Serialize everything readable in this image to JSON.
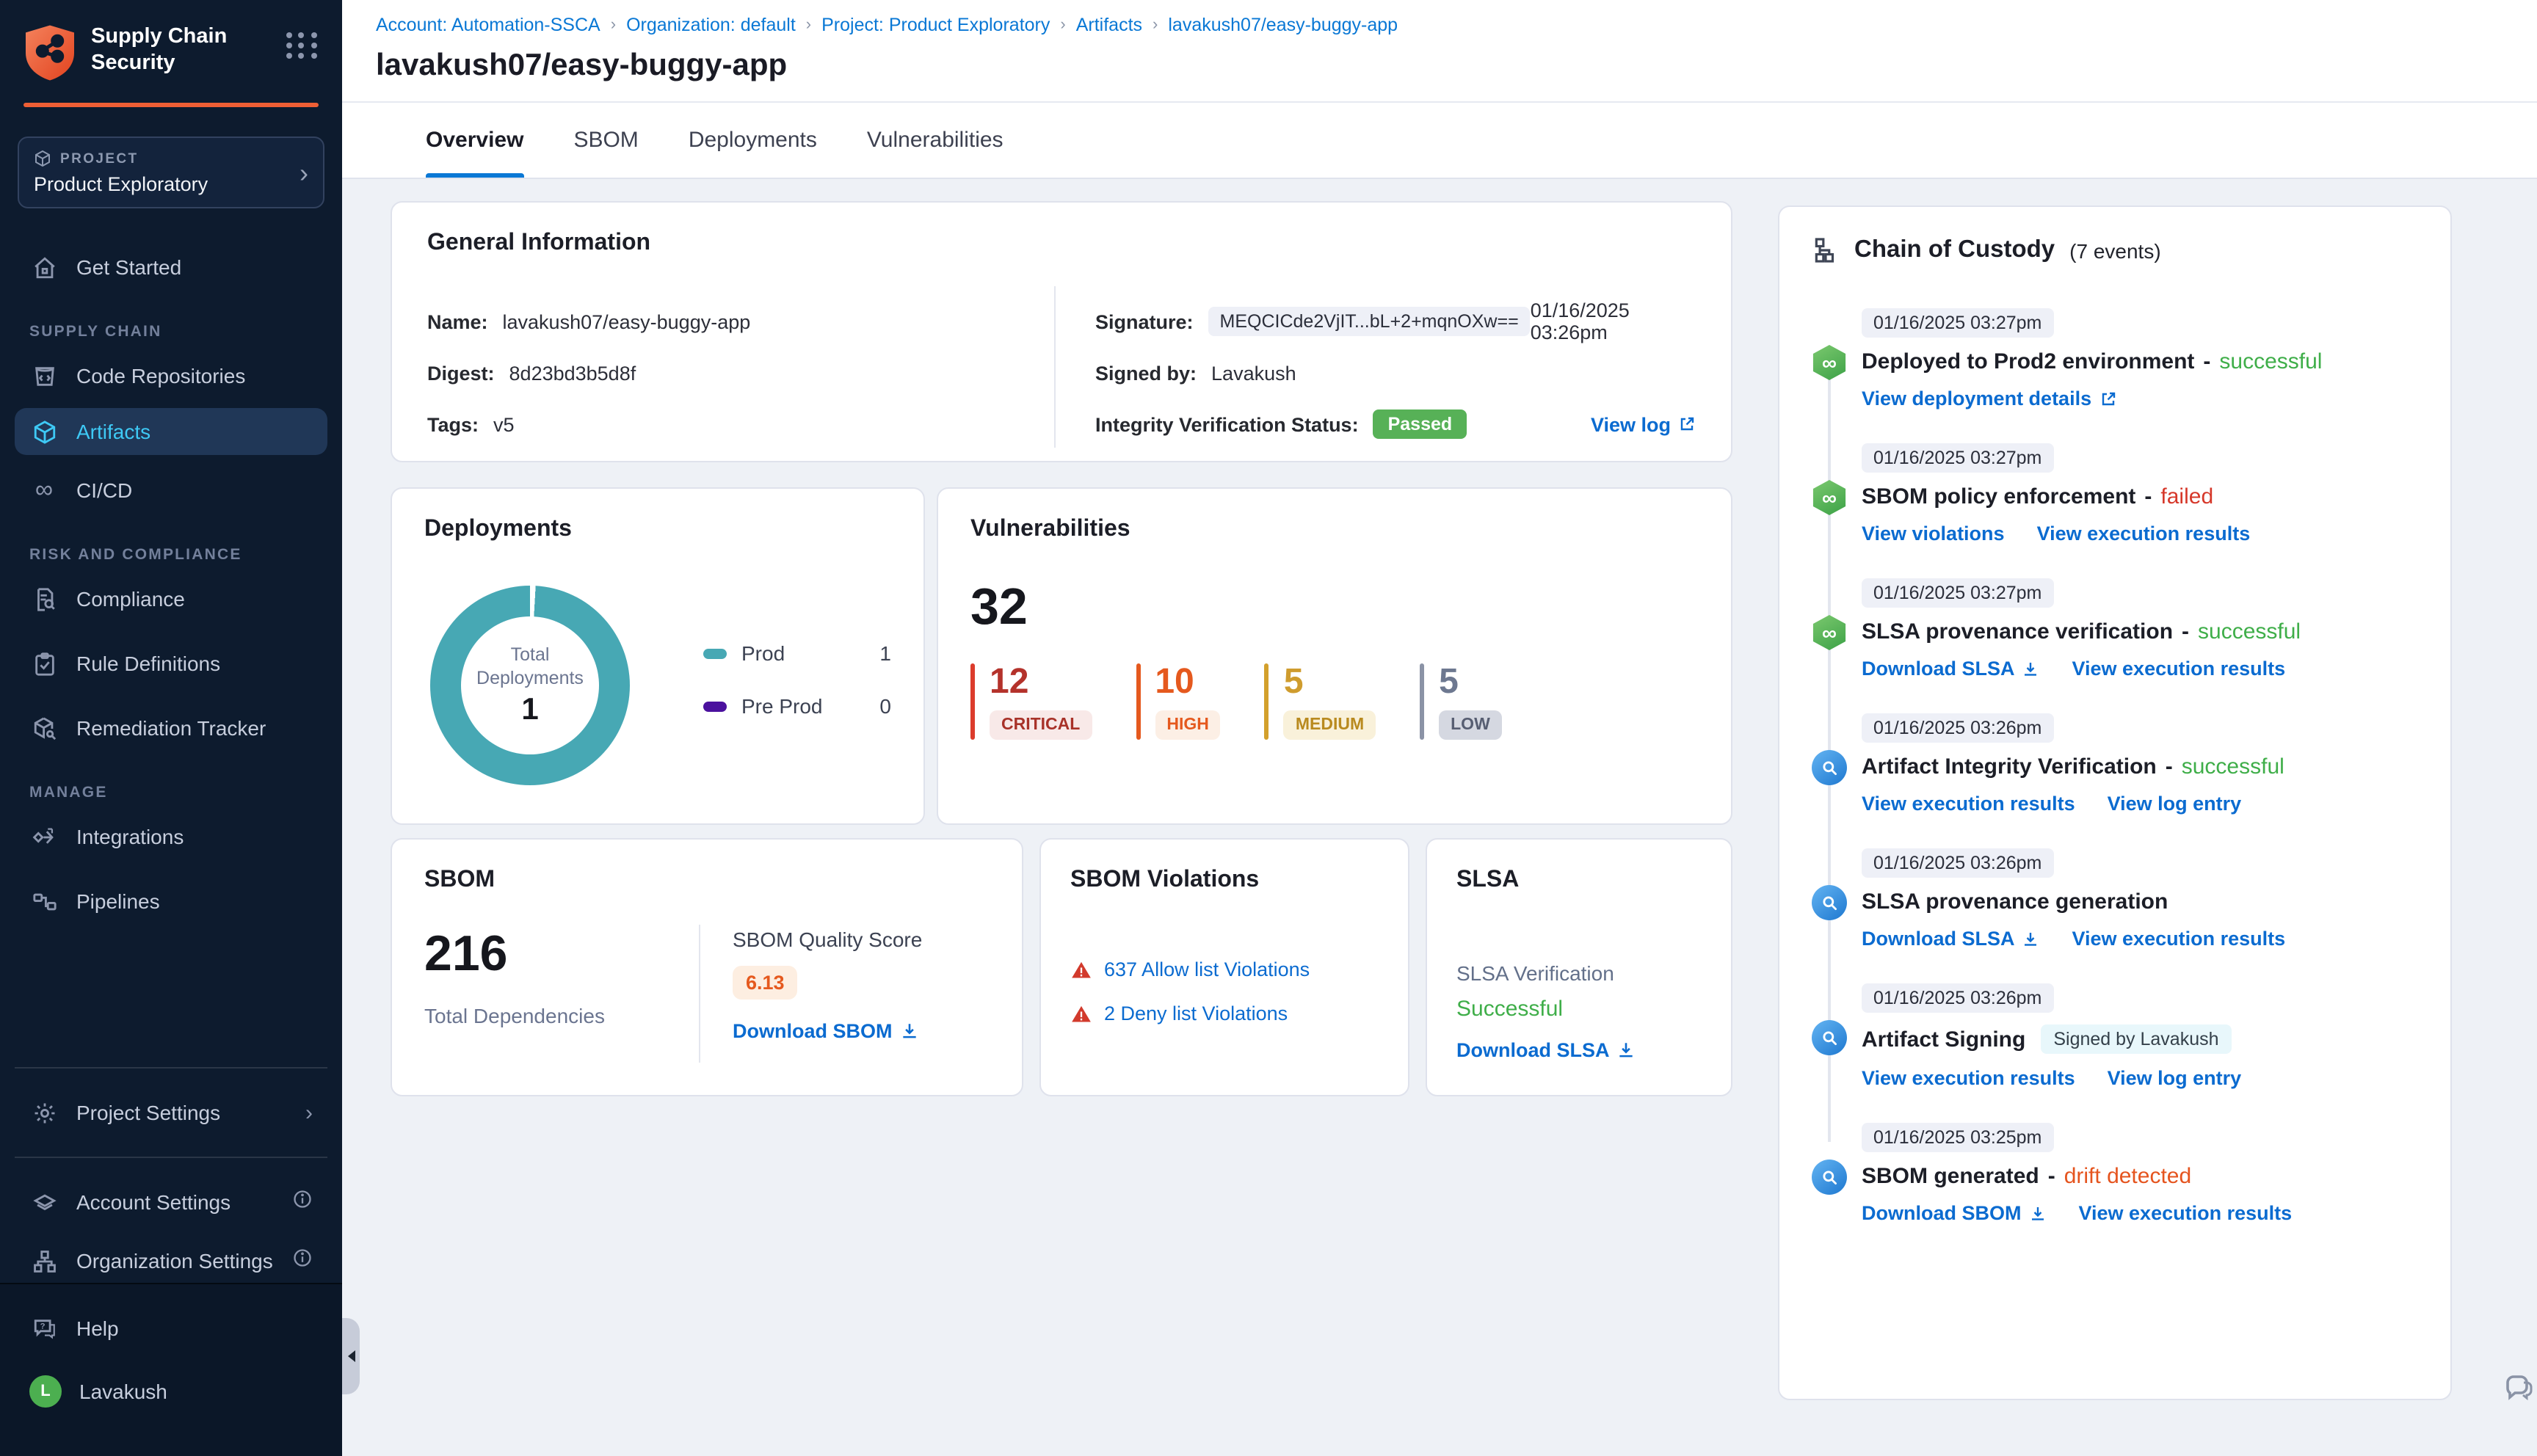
{
  "sidebar": {
    "product_line1": "Supply Chain",
    "product_line2": "Security",
    "project_label": "PROJECT",
    "project_name": "Product Exploratory",
    "item_get_started": "Get Started",
    "section_supply_chain": "SUPPLY CHAIN",
    "item_code_repositories": "Code Repositories",
    "item_artifacts": "Artifacts",
    "item_cicd": "CI/CD",
    "section_risk": "RISK AND COMPLIANCE",
    "item_compliance": "Compliance",
    "item_rule_definitions": "Rule Definitions",
    "item_remediation": "Remediation Tracker",
    "section_manage": "MANAGE",
    "item_integrations": "Integrations",
    "item_pipelines": "Pipelines",
    "item_project_settings": "Project Settings",
    "item_account_settings": "Account Settings",
    "item_org_settings": "Organization Settings",
    "item_help": "Help",
    "user_initial": "L",
    "user_name": "Lavakush"
  },
  "breadcrumb": {
    "account": "Account: Automation-SSCA",
    "org": "Organization: default",
    "project": "Project: Product Exploratory",
    "artifacts": "Artifacts",
    "artifact": "lavakush07/easy-buggy-app"
  },
  "page": {
    "title": "lavakush07/easy-buggy-app"
  },
  "tabs": {
    "overview": "Overview",
    "sbom": "SBOM",
    "deployments": "Deployments",
    "vulnerabilities": "Vulnerabilities"
  },
  "general_info": {
    "title": "General Information",
    "name_label": "Name:",
    "name": "lavakush07/easy-buggy-app",
    "digest_label": "Digest:",
    "digest": "8d23bd3b5d8f",
    "tags_label": "Tags:",
    "tags": "v5",
    "signature_label": "Signature:",
    "signature": "MEQCICde2VjIT...bL+2+mqnOXw==",
    "signature_time": "01/16/2025 03:26pm",
    "signed_by_label": "Signed by:",
    "signed_by": "Lavakush",
    "integrity_label": "Integrity Verification Status:",
    "integrity_status": "Passed",
    "view_log": "View log"
  },
  "deployments_card": {
    "title": "Deployments",
    "center_label_1": "Total",
    "center_label_2": "Deployments",
    "total": "1",
    "legend": [
      {
        "label": "Prod",
        "value": "1",
        "color": "#47a8b4"
      },
      {
        "label": "Pre Prod",
        "value": "0",
        "color": "#4b119e"
      }
    ]
  },
  "vulnerabilities_card": {
    "title": "Vulnerabilities",
    "total": "32",
    "severities": [
      {
        "count": "12",
        "label": "CRITICAL",
        "color": "#b4322b"
      },
      {
        "count": "10",
        "label": "HIGH",
        "color": "#e5591e"
      },
      {
        "count": "5",
        "label": "MEDIUM",
        "color": "#cf9c2e"
      },
      {
        "count": "5",
        "label": "LOW",
        "color": "#6d7890"
      }
    ]
  },
  "sbom_card": {
    "title": "SBOM",
    "total": "216",
    "total_label": "Total Dependencies",
    "quality_label": "SBOM Quality Score",
    "quality_score": "6.13",
    "download": "Download SBOM"
  },
  "violations_card": {
    "title": "SBOM Violations",
    "allow": "637 Allow list Violations",
    "deny": "2 Deny list Violations"
  },
  "slsa_card": {
    "title": "SLSA",
    "verification_label": "SLSA Verification",
    "status": "Successful",
    "download": "Download SLSA"
  },
  "custody": {
    "title": "Chain of Custody",
    "count": "(7 events)",
    "events": [
      {
        "time": "01/16/2025 03:27pm",
        "title": "Deployed to Prod2 environment",
        "dash": "-",
        "status": "successful",
        "links": [
          "View deployment details"
        ]
      },
      {
        "time": "01/16/2025 03:27pm",
        "title": "SBOM policy enforcement",
        "dash": "-",
        "status": "failed",
        "links": [
          "View violations",
          "View execution results"
        ]
      },
      {
        "time": "01/16/2025 03:27pm",
        "title": "SLSA provenance verification",
        "dash": "-",
        "status": "successful",
        "links": [
          "Download SLSA",
          "View execution results"
        ]
      },
      {
        "time": "01/16/2025 03:26pm",
        "title": "Artifact Integrity Verification",
        "dash": "-",
        "status": "successful",
        "links": [
          "View execution results",
          "View log entry"
        ]
      },
      {
        "time": "01/16/2025 03:26pm",
        "title": "SLSA provenance generation",
        "dash": "",
        "status": "",
        "links": [
          "Download SLSA",
          "View execution results"
        ]
      },
      {
        "time": "01/16/2025 03:26pm",
        "title": "Artifact Signing",
        "badge": "Signed by Lavakush",
        "dash": "",
        "status": "",
        "links": [
          "View execution results",
          "View log entry"
        ]
      },
      {
        "time": "01/16/2025 03:25pm",
        "title": "SBOM generated",
        "dash": "-",
        "status": "drift detected",
        "links": [
          "Download SBOM",
          "View execution results"
        ]
      }
    ]
  },
  "colors": {
    "brand_orange": "#ee5f35",
    "link_blue": "#0b6bd0",
    "harness_blue": "#0a78d5",
    "success_green": "#3fae49",
    "fail_red": "#d6382a",
    "drift_orange": "#e5541e",
    "teal_donut": "#47a8b4",
    "preprod_purple": "#4b119e",
    "passed_badge_green": "#57b157"
  }
}
